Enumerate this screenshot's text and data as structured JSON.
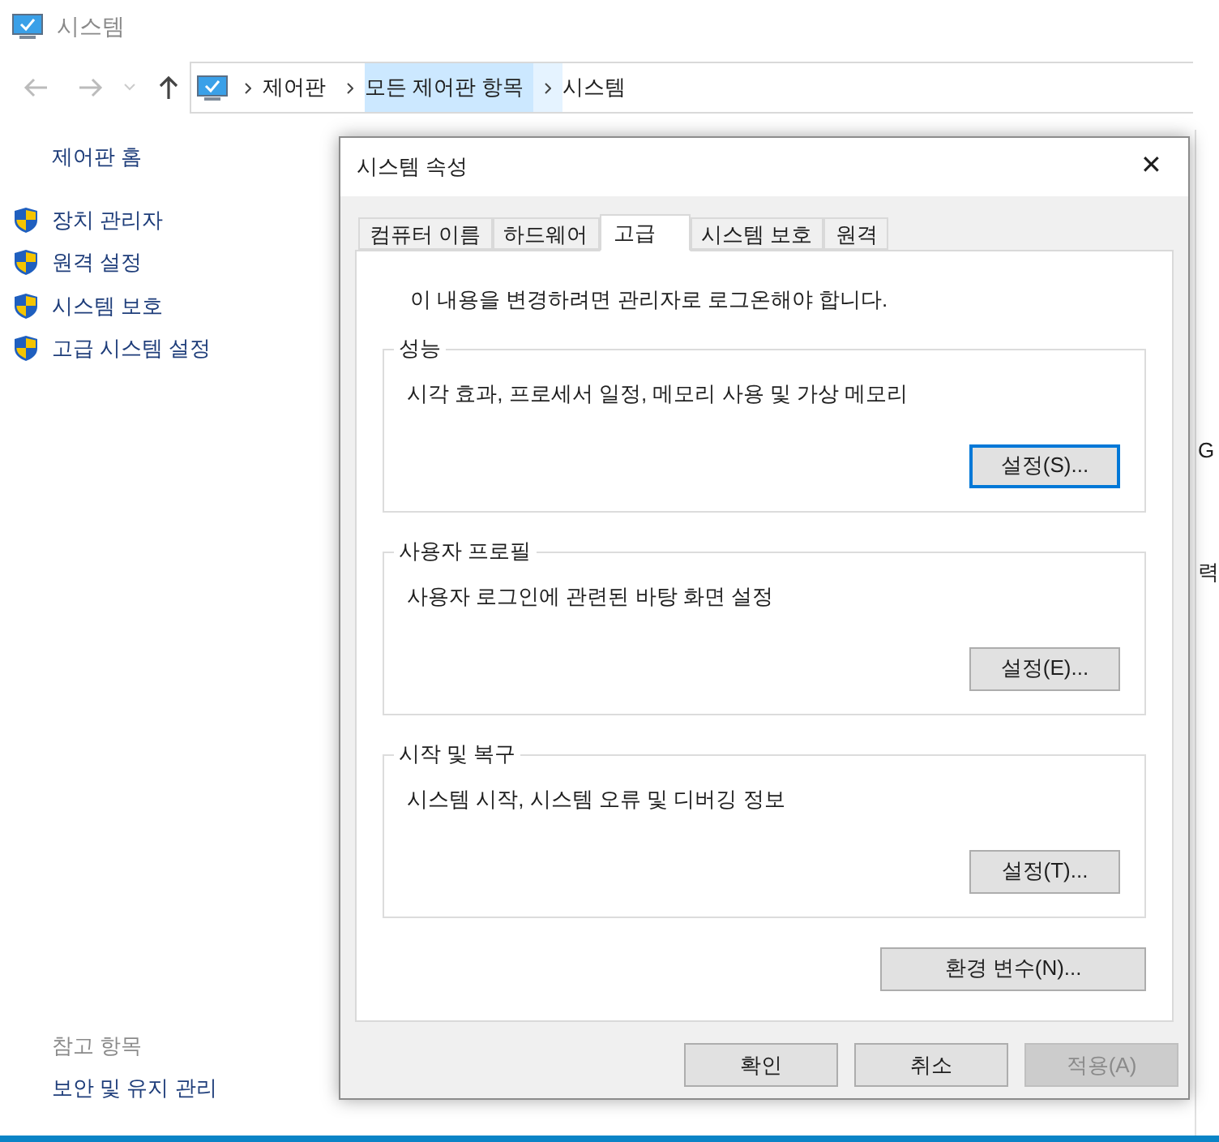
{
  "window": {
    "title": "시스템"
  },
  "address_bar": {
    "segments": [
      {
        "label": "제어판",
        "selected": false
      },
      {
        "label": "모든 제어판 항목",
        "selected": true
      },
      {
        "label": "시스템",
        "selected": false
      }
    ]
  },
  "sidebar": {
    "home": "제어판 홈",
    "items": [
      "장치 관리자",
      "원격 설정",
      "시스템 보호",
      "고급 시스템 설정"
    ],
    "see_also_title": "참고 항목",
    "see_also": [
      "보안 및 유지 관리"
    ]
  },
  "background_fragments": [
    "G",
    "력"
  ],
  "dialog": {
    "title": "시스템 속성",
    "close": "✕",
    "tabs": [
      {
        "label": "컴퓨터 이름",
        "selected": false
      },
      {
        "label": "하드웨어",
        "selected": false
      },
      {
        "label": "고급",
        "selected": true
      },
      {
        "label": "시스템 보호",
        "selected": false
      },
      {
        "label": "원격",
        "selected": false
      }
    ],
    "notice": "이 내용을 변경하려면 관리자로 로그온해야 합니다.",
    "groups": [
      {
        "title": "성능",
        "description": "시각 효과, 프로세서 일정, 메모리 사용 및 가상 메모리",
        "button": "설정(S)...",
        "focused": true
      },
      {
        "title": "사용자 프로필",
        "description": "사용자 로그인에 관련된 바탕 화면 설정",
        "button": "설정(E)...",
        "focused": false
      },
      {
        "title": "시작 및 복구",
        "description": "시스템 시작, 시스템 오류 및 디버깅 정보",
        "button": "설정(T)...",
        "focused": false
      }
    ],
    "env_button": "환경 변수(N)...",
    "buttons": [
      {
        "label": "확인",
        "disabled": false
      },
      {
        "label": "취소",
        "disabled": false
      },
      {
        "label": "적용(A)",
        "disabled": true
      }
    ]
  }
}
